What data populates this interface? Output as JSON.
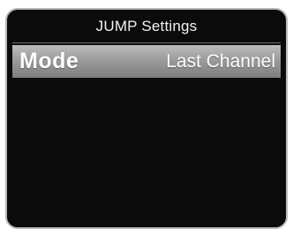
{
  "screen": {
    "title": "JUMP Settings"
  },
  "menu": {
    "items": [
      {
        "label": "Mode",
        "value": "Last Channel",
        "selected": true
      }
    ]
  },
  "colors": {
    "background": "#0b0b0b",
    "border": "#b8b8b8",
    "highlight_top": "#bdbdbd",
    "highlight_bottom": "#7d7d7d",
    "text": "#ffffff"
  }
}
